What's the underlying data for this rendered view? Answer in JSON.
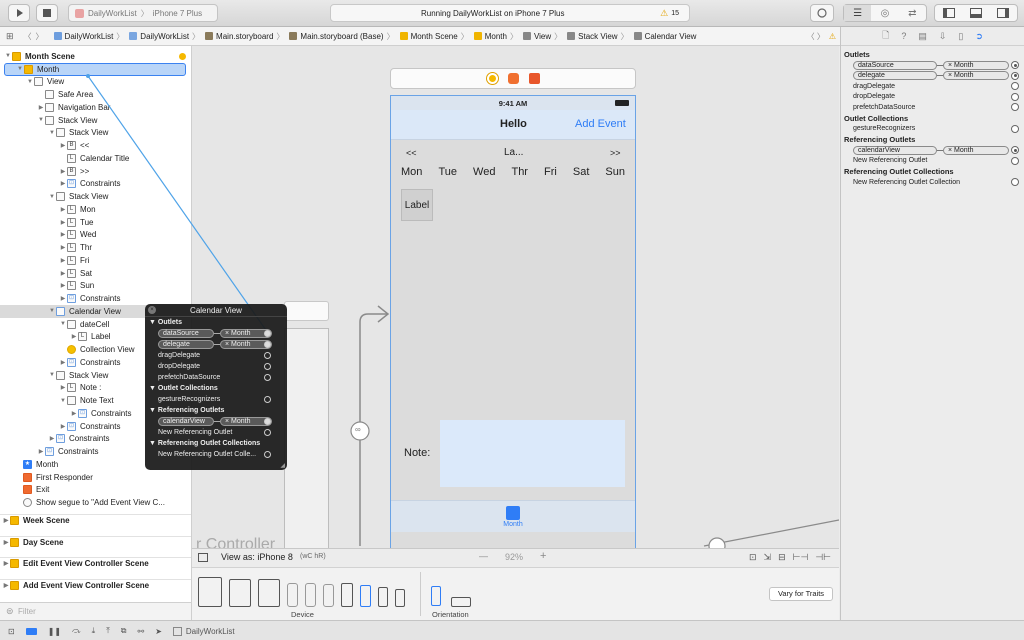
{
  "toolbar": {
    "scheme_name": "DailyWorkList",
    "device": "iPhone 7 Plus",
    "activity_text": "Running DailyWorkList on iPhone 7 Plus",
    "warning_count": "15"
  },
  "jumpbar": {
    "items": [
      "DailyWorkList",
      "DailyWorkList",
      "Main.storyboard",
      "Main.storyboard (Base)",
      "Month Scene",
      "Month",
      "View",
      "Stack View",
      "Calendar View"
    ]
  },
  "outline": {
    "rows": [
      {
        "label": "Month Scene",
        "icon": "scene-icon"
      },
      {
        "label": "Month",
        "icon": "view-controller-icon"
      },
      {
        "label": "View",
        "icon": "view-icon"
      },
      {
        "label": "Safe Area",
        "icon": "safe-area-icon"
      },
      {
        "label": "Navigation Bar",
        "icon": "navigation-bar-icon"
      },
      {
        "label": "Stack View",
        "icon": "stack-view-icon"
      },
      {
        "label": "Stack View",
        "icon": "stack-view-icon"
      },
      {
        "label": "<<",
        "icon": "button-icon"
      },
      {
        "label": "Calendar Title",
        "icon": "label-icon"
      },
      {
        "label": ">>",
        "icon": "button-icon"
      },
      {
        "label": "Constraints",
        "icon": "constraints-icon"
      },
      {
        "label": "Stack View",
        "icon": "stack-view-icon"
      },
      {
        "label": "Mon",
        "icon": "label-icon"
      },
      {
        "label": "Tue",
        "icon": "label-icon"
      },
      {
        "label": "Wed",
        "icon": "label-icon"
      },
      {
        "label": "Thr",
        "icon": "label-icon"
      },
      {
        "label": "Fri",
        "icon": "label-icon"
      },
      {
        "label": "Sat",
        "icon": "label-icon"
      },
      {
        "label": "Sun",
        "icon": "label-icon"
      },
      {
        "label": "Constraints",
        "icon": "constraints-icon"
      },
      {
        "label": "Calendar View",
        "icon": "collection-view-icon"
      },
      {
        "label": "dateCell",
        "icon": "cell-icon"
      },
      {
        "label": "Label",
        "icon": "label-icon"
      },
      {
        "label": "Collection View",
        "icon": "layout-icon"
      },
      {
        "label": "Constraints",
        "icon": "constraints-icon"
      },
      {
        "label": "Stack View",
        "icon": "stack-view-icon"
      },
      {
        "label": "Note :",
        "icon": "label-icon"
      },
      {
        "label": "Note Text",
        "icon": "text-view-icon"
      },
      {
        "label": "Constraints",
        "icon": "constraints-icon"
      },
      {
        "label": "Constraints",
        "icon": "constraints-icon"
      },
      {
        "label": "Constraints",
        "icon": "constraints-icon"
      },
      {
        "label": "Constraints",
        "icon": "constraints-icon"
      },
      {
        "label": "Month",
        "icon": "star-icon"
      },
      {
        "label": "First Responder",
        "icon": "first-responder-icon"
      },
      {
        "label": "Exit",
        "icon": "exit-icon"
      },
      {
        "label": "Show segue to \"Add Event View C...",
        "icon": "segue-icon"
      }
    ],
    "scenes": [
      "Week Scene",
      "Day Scene",
      "Edit Event View Controller Scene",
      "Add Event View Controller Scene"
    ],
    "filter_placeholder": "Filter"
  },
  "phone": {
    "status_time": "9:41 AM",
    "nav_title": "Hello",
    "nav_action": "Add Event",
    "prev": "<<",
    "title": "La...",
    "next": ">>",
    "weekdays": [
      "Mon",
      "Tue",
      "Wed",
      "Thr",
      "Fri",
      "Sat",
      "Sun"
    ],
    "cell_label": "Label",
    "note_label": "Note:",
    "tab_item": "Month"
  },
  "canvas": {
    "scene_caption": "r Controller"
  },
  "popup": {
    "title": "Calendar View",
    "sections": [
      {
        "title": "Outlets",
        "rows": [
          {
            "name": "dataSource",
            "target": "Month"
          },
          {
            "name": "delegate",
            "target": "Month"
          },
          {
            "name": "dragDelegate",
            "target": ""
          },
          {
            "name": "dropDelegate",
            "target": ""
          },
          {
            "name": "prefetchDataSource",
            "target": ""
          }
        ]
      },
      {
        "title": "Outlet Collections",
        "rows": [
          {
            "name": "gestureRecognizers",
            "target": ""
          }
        ]
      },
      {
        "title": "Referencing Outlets",
        "rows": [
          {
            "name": "calendarView",
            "target": "Month"
          },
          {
            "name": "New Referencing Outlet",
            "target": ""
          }
        ]
      },
      {
        "title": "Referencing Outlet Collections",
        "rows": [
          {
            "name": "New Referencing Outlet Colle...",
            "target": ""
          }
        ]
      }
    ]
  },
  "inspector": {
    "sections": [
      {
        "title": "Outlets",
        "rows": [
          {
            "name": "dataSource",
            "target": "Month"
          },
          {
            "name": "delegate",
            "target": "Month"
          },
          {
            "name": "dragDelegate",
            "target": ""
          },
          {
            "name": "dropDelegate",
            "target": ""
          },
          {
            "name": "prefetchDataSource",
            "target": ""
          }
        ]
      },
      {
        "title": "Outlet Collections",
        "rows": [
          {
            "name": "gestureRecognizers",
            "target": ""
          }
        ]
      },
      {
        "title": "Referencing Outlets",
        "rows": [
          {
            "name": "calendarView",
            "target": "Month"
          },
          {
            "name": "New Referencing Outlet",
            "target": ""
          }
        ]
      },
      {
        "title": "Referencing Outlet Collections",
        "rows": [
          {
            "name": "New Referencing Outlet Collection",
            "target": ""
          }
        ]
      }
    ]
  },
  "bottom": {
    "view_as": "View as: iPhone 8",
    "size_class": "(wC hR)",
    "zoom": "92%",
    "minus": "—",
    "plus": "+",
    "device_label": "Device",
    "orientation_label": "Orientation",
    "vary_button": "Vary for Traits"
  },
  "statusbar": {
    "target": "DailyWorkList"
  },
  "colors": {
    "accent": "#2f7df6",
    "selection": "#b9d5f8",
    "nav_bg": "#dbe8f8",
    "connection_line": "#4fa3e8"
  }
}
